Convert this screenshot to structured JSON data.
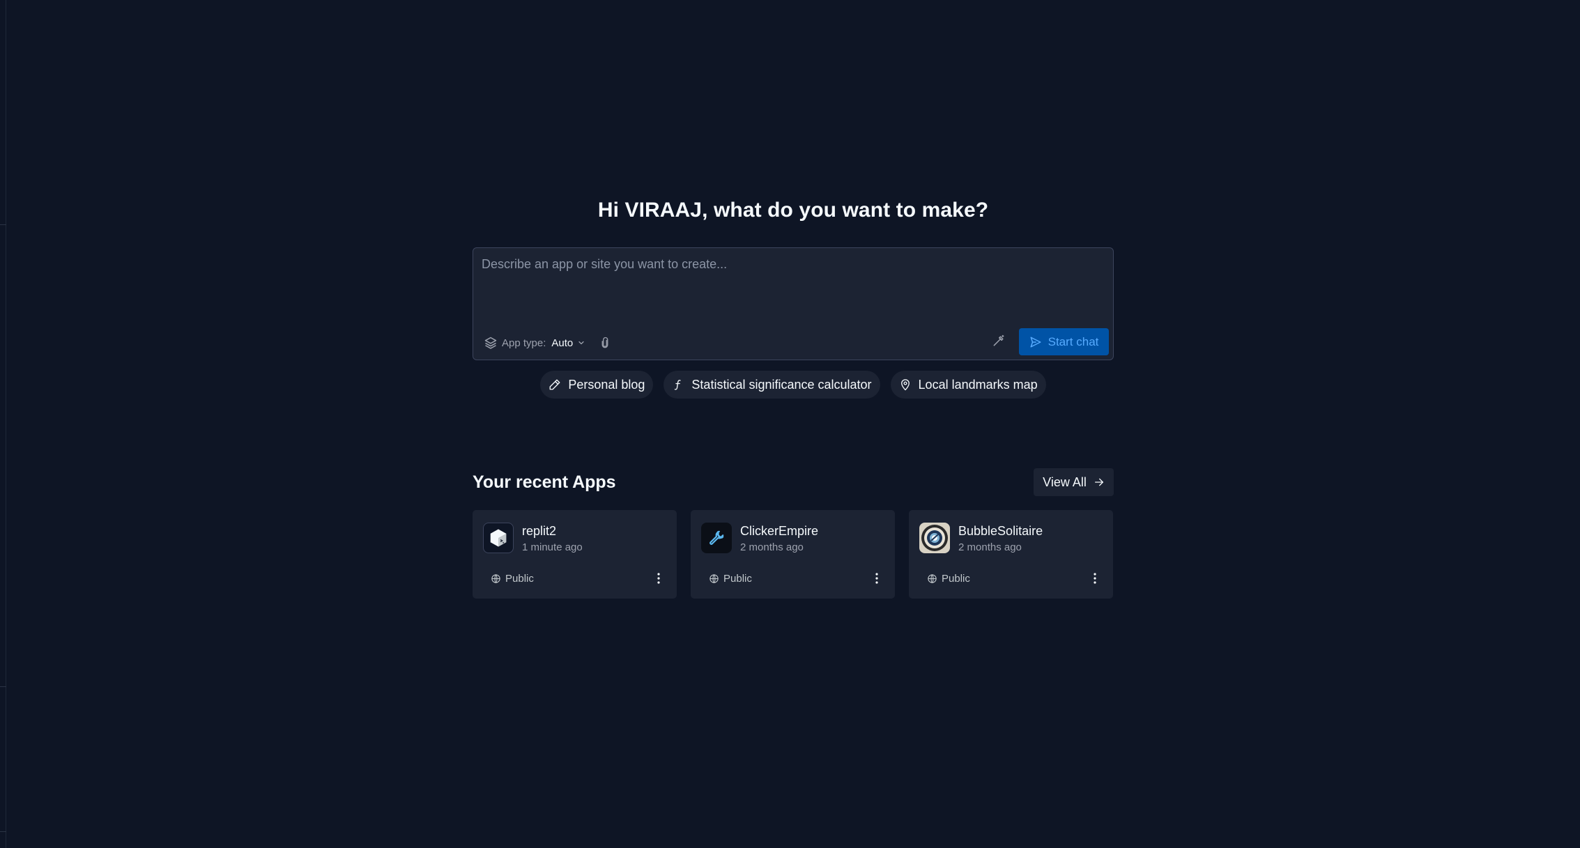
{
  "greeting": "Hi VIRAAJ, what do you want to make?",
  "composer": {
    "placeholder": "Describe an app or site you want to create...",
    "app_type_label": "App type:",
    "app_type_value": "Auto",
    "start_chat_label": "Start chat"
  },
  "suggestions": [
    {
      "label": "Personal blog",
      "icon": "pencil-icon"
    },
    {
      "label": "Statistical significance calculator",
      "icon": "function-icon"
    },
    {
      "label": "Local landmarks map",
      "icon": "map-pin-icon"
    }
  ],
  "recent": {
    "title": "Your recent Apps",
    "view_all_label": "View All",
    "apps": [
      {
        "name": "replit2",
        "time": "1 minute ago",
        "visibility": "Public",
        "icon": "cube-icon"
      },
      {
        "name": "ClickerEmpire",
        "time": "2 months ago",
        "visibility": "Public",
        "icon": "wrench-icon"
      },
      {
        "name": "BubbleSolitaire",
        "time": "2 months ago",
        "visibility": "Public",
        "icon": "bubble-icon"
      }
    ]
  },
  "colors": {
    "background": "#0e1525",
    "surface": "#1c2333",
    "accent_bg": "#0053a6",
    "accent_text": "#57abff"
  }
}
